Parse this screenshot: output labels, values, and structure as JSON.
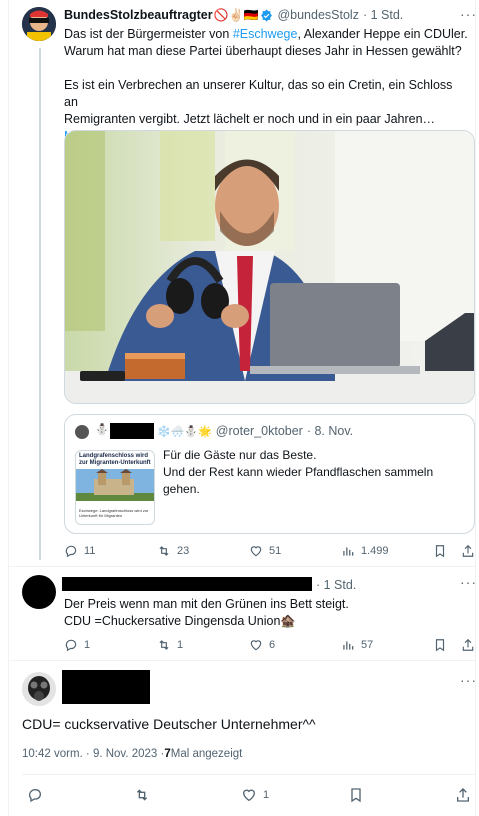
{
  "tweet1": {
    "display_name": "BundesStolzbeauftragter",
    "name_emojis": "🚫✌🏻🇩🇪",
    "handle": "@bundesStolz",
    "time": "· 1 Std.",
    "line1_pre": "Das ist der Bürgermeister von ",
    "hashtag": "#Eschwege",
    "line1_post": ", Alexander Heppe ein CDUler.",
    "line2": "Warum hat man diese Partei überhaupt dieses Jahr in Hessen gewählt?",
    "line3": "Es ist ein Verbrechen an unserer Kultur, das so ein Cretin, ein Schloss an",
    "line4": "Remigranten vergibt. Jetzt lächelt er noch und in ein paar Jahren…",
    "show_more": "Mehr anzeigen",
    "replies": "11",
    "retweets": "23",
    "likes": "51",
    "views": "1.499"
  },
  "quote": {
    "emojis": "❄️🌨️⛄🌟",
    "handle": "@roter_0ktober",
    "time": "· 8. Nov.",
    "thumb_title": "Landgrafenschloss wird zur Migranten-Unterkunft",
    "thumb_caption": "Eschwege: Landgrafenschloss wird zur Unterkunft für Migranten",
    "line1": "Für die Gäste nur das Beste.",
    "line2": "Und der Rest kann wieder Pfandflaschen sammeln",
    "line3": "gehen."
  },
  "tweet2": {
    "time": "· 1 Std.",
    "line1": "Der Preis wenn man mit den Grünen ins Bett steigt.",
    "line2": "CDU =Chuckersative Dingensda Union🏚️",
    "replies": "1",
    "retweets": "1",
    "likes": "6",
    "views": "57"
  },
  "tweet3": {
    "text": "CDU= cuckservative Deutscher Unternehmer^^",
    "time": "10:42 vorm. · 9. Nov. 2023 · ",
    "views_count": "7",
    "views_label": " Mal angezeigt",
    "likes": "1"
  },
  "colors": {
    "accent": "#1d9bf0",
    "muted": "#536471",
    "border": "#cfd9de"
  }
}
